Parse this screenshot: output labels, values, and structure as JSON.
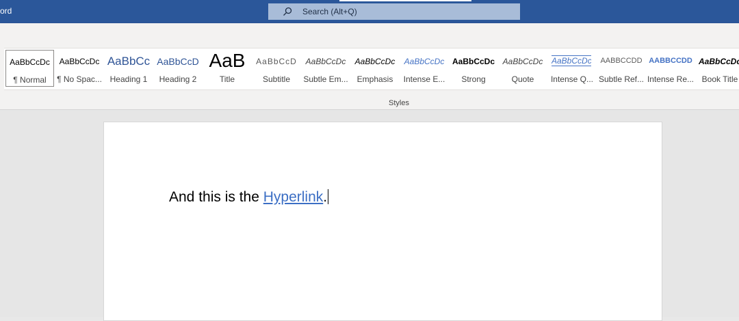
{
  "titlebar": {
    "app_name_partial": "ord",
    "bg_color": "#2b579a"
  },
  "search": {
    "label": "Search (Alt+Q)"
  },
  "ribbon": {
    "group_label": "Styles",
    "styles": [
      {
        "preview": "AaBbCcDc",
        "label": "¶ Normal"
      },
      {
        "preview": "AaBbCcDc",
        "label": "¶ No Spac..."
      },
      {
        "preview": "AaBbCc",
        "label": "Heading 1"
      },
      {
        "preview": "AaBbCcD",
        "label": "Heading 2"
      },
      {
        "preview": "AaB",
        "label": "Title"
      },
      {
        "preview": "AaBbCcD",
        "label": "Subtitle"
      },
      {
        "preview": "AaBbCcDc",
        "label": "Subtle Em..."
      },
      {
        "preview": "AaBbCcDc",
        "label": "Emphasis"
      },
      {
        "preview": "AaBbCcDc",
        "label": "Intense E..."
      },
      {
        "preview": "AaBbCcDc",
        "label": "Strong"
      },
      {
        "preview": "AaBbCcDc",
        "label": "Quote"
      },
      {
        "preview": "AaBbCcDc",
        "label": "Intense Q..."
      },
      {
        "preview": "AABBCCDD",
        "label": "Subtle Ref..."
      },
      {
        "preview": "AABBCCDD",
        "label": "Intense Re..."
      },
      {
        "preview": "AaBbCcDc",
        "label": "Book Title"
      }
    ]
  },
  "document": {
    "text_before": "And this is the ",
    "link_text": "Hyperlink",
    "text_after": ".",
    "link_color": "#3b6ec4"
  }
}
